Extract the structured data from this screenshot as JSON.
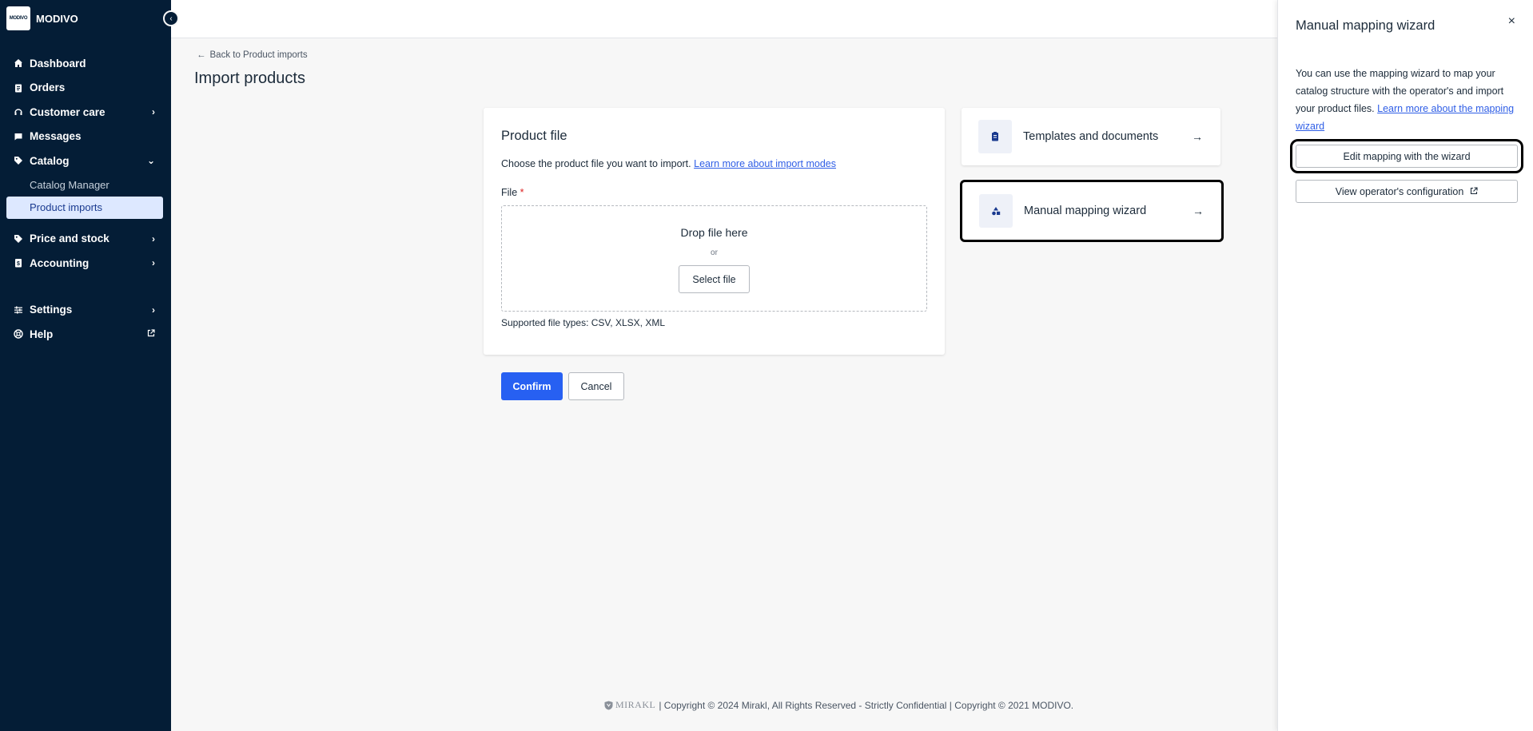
{
  "brand": {
    "logo_text": "MODIVO",
    "name": "MODIVO"
  },
  "sidebar": {
    "items": [
      {
        "label": "Dashboard",
        "icon": "home-icon"
      },
      {
        "label": "Orders",
        "icon": "clipboard-icon"
      },
      {
        "label": "Customer care",
        "icon": "headset-icon"
      },
      {
        "label": "Messages",
        "icon": "message-icon"
      },
      {
        "label": "Catalog",
        "icon": "tag-icon"
      }
    ],
    "catalog_sub": [
      {
        "label": "Catalog Manager"
      },
      {
        "label": "Product imports"
      }
    ],
    "items2": [
      {
        "label": "Price and stock",
        "icon": "price-tag-icon"
      },
      {
        "label": "Accounting",
        "icon": "document-icon"
      }
    ],
    "items3": [
      {
        "label": "Settings",
        "icon": "sliders-icon"
      },
      {
        "label": "Help",
        "icon": "lifebuoy-icon"
      }
    ]
  },
  "main": {
    "back_link": "Back to Product imports",
    "title": "Import products",
    "product_file": {
      "heading": "Product file",
      "description": "Choose the product file you want to import.",
      "learn_link": "Learn more about import modes",
      "file_label": "File",
      "required_mark": "*",
      "drop_text": "Drop file here",
      "or_text": "or",
      "select_button": "Select file",
      "supported": "Supported file types: CSV, XLSX, XML"
    },
    "confirm": "Confirm",
    "cancel": "Cancel",
    "side_cards": {
      "templates": "Templates and documents",
      "wizard": "Manual mapping wizard"
    }
  },
  "footer": {
    "logo": "MIRAKL",
    "text": "| Copyright © 2024 Mirakl, All Rights Reserved - Strictly Confidential | Copyright © 2021 MODIVO."
  },
  "drawer": {
    "title": "Manual mapping wizard",
    "close": "×",
    "text": "You can use the mapping wizard to map your catalog structure with the operator's and import your product files.",
    "link": "Learn more about the mapping wizard",
    "edit_button": "Edit mapping with the wizard",
    "view_button": "View operator's configuration"
  },
  "colors": {
    "sidebar": "#041d36",
    "primary": "#2760f2",
    "active_bg": "#dde8ff"
  }
}
